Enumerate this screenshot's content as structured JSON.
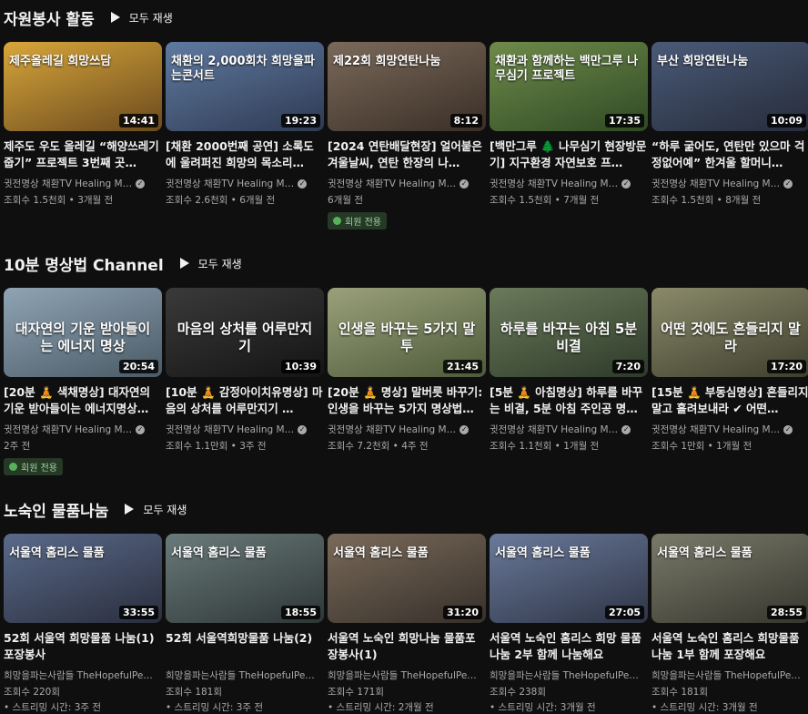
{
  "play_all_label": "모두 재생",
  "shelves": [
    {
      "title": "자원봉사 활동",
      "videos": [
        {
          "thumb_text": "제주올레길 희망쓰담",
          "duration": "14:41",
          "title": "제주도 우도 올레길 “해양쓰레기줍기” 프로젝트 3번째 곳…",
          "channel": "귓전명상 채환TV Healing M…",
          "views": "조회수 1.5천회 • 3개월 전",
          "badge": "",
          "colors": [
            "#d8a63a",
            "#6a4a1e"
          ]
        },
        {
          "thumb_text": "채환의 2,000회차 희망을파는콘서트",
          "duration": "19:23",
          "title": "[채환 2000번째 공연] 소록도에 울려퍼진 희망의 목소리…",
          "channel": "귓전명상 채환TV Healing M…",
          "views": "조회수 2.6천회 • 6개월 전",
          "badge": "",
          "colors": [
            "#5f7aa0",
            "#2e3a52"
          ]
        },
        {
          "thumb_text": "제22회 희망연탄나눔",
          "duration": "8:12",
          "title": "[2024 연탄배달현장] 얼어붙은 겨울날씨, 연탄 한장의 나…",
          "channel": "귓전명상 채환TV Healing M…",
          "views": "6개월 전",
          "badge": "회원 전용",
          "colors": [
            "#7a6a5a",
            "#3a2e26"
          ]
        },
        {
          "thumb_text": "채환과 함께하는 백만그루 나무심기 프로젝트",
          "duration": "17:35",
          "title": "[백만그루 🌲 나무심기 현장방문기] 지구환경 자연보호 프…",
          "channel": "귓전명상 채환TV Healing M…",
          "views": "조회수 1.5천회 • 7개월 전",
          "badge": "",
          "colors": [
            "#6f8a4a",
            "#2f4a24"
          ]
        },
        {
          "thumb_text": "부산 희망연탄나눔",
          "duration": "10:09",
          "title": "“하루 굶어도, 연탄만 있으마 걱정없어예” 한겨울 할머니…",
          "channel": "귓전명상 채환TV Healing M…",
          "views": "조회수 1.5천회 • 8개월 전",
          "badge": "",
          "colors": [
            "#4a5a78",
            "#262c3a"
          ]
        }
      ]
    },
    {
      "title": "10분 명상법 Channel",
      "videos": [
        {
          "thumb_text": "대자연의 기운 받아들이는 에너지 명상",
          "duration": "20:54",
          "title": "[20분 🧘 색채명상] 대자연의 기운 받아들이는 에너지명상…",
          "channel": "귓전명상 채환TV Healing M…",
          "views": "2주 전",
          "badge": "회원 전용",
          "colors": [
            "#8fa4b4",
            "#4a5a66"
          ]
        },
        {
          "thumb_text": "마음의 상처를 어루만지기",
          "duration": "10:39",
          "title": "[10분 🧘 감정아이치유명상] 마음의 상처를 어루만지기 …",
          "channel": "귓전명상 채환TV Healing M…",
          "views": "조회수 1.1만회 • 3주 전",
          "badge": "",
          "colors": [
            "#3a3a3a",
            "#141414"
          ]
        },
        {
          "thumb_text": "인생을 바꾸는 5가지 말투",
          "duration": "21:45",
          "title": "[20분 🧘 명상] 말버릇 바꾸기: 인생을 바꾸는 5가지 명상법…",
          "channel": "귓전명상 채환TV Healing M…",
          "views": "조회수 7.2천회 • 4주 전",
          "badge": "",
          "colors": [
            "#9aa07a",
            "#4e5a3a"
          ]
        },
        {
          "thumb_text": "하루를 바꾸는 아침 5분 비결",
          "duration": "7:20",
          "title": "[5분 🧘 아침명상] 하루를 바꾸는 비결, 5분 아침 주인공 명…",
          "channel": "귓전명상 채환TV Healing M…",
          "views": "조회수 1.1천회 • 1개월 전",
          "badge": "",
          "colors": [
            "#6a7a5a",
            "#2e3a2a"
          ]
        },
        {
          "thumb_text": "어떤 것에도 흔들리지 말라",
          "duration": "17:20",
          "title": "[15분 🧘 부동심명상] 흔들리지 말고 흘려보내라 ✔ 어떤…",
          "channel": "귓전명상 채환TV Healing M…",
          "views": "조회수 1만회 • 1개월 전",
          "badge": "",
          "colors": [
            "#8a8a6a",
            "#3e3e2e"
          ]
        }
      ]
    },
    {
      "title": "노숙인 물품나눔",
      "videos": [
        {
          "thumb_text": "서울역 홈리스 물품",
          "duration": "33:55",
          "title": "52회 서울역 희망물품 나눔(1) 포장봉사",
          "channel": "희망을파는사람들 TheHopefulPe…",
          "views": "조회수 220회",
          "views2": "• 스트리밍 시간: 3주 전",
          "badge": "",
          "colors": [
            "#5a6a8a",
            "#2a2e3e"
          ]
        },
        {
          "thumb_text": "서울역 홈리스 물품",
          "duration": "18:55",
          "title": "52회 서울역희망물품 나눔(2)",
          "channel": "희망을파는사람들 TheHopefulPe…",
          "views": "조회수 181회",
          "views2": "• 스트리밍 시간: 3주 전",
          "badge": "",
          "colors": [
            "#6a7a7a",
            "#2e3636"
          ]
        },
        {
          "thumb_text": "서울역 홈리스 물품",
          "duration": "31:20",
          "title": "서울역 노숙인 희망나눔 물품포장봉사(1)",
          "channel": "희망을파는사람들 TheHopefulPe…",
          "views": "조회수 171회",
          "views2": "• 스트리밍 시간: 2개월 전",
          "badge": "",
          "colors": [
            "#7a6a5a",
            "#36302a"
          ]
        },
        {
          "thumb_text": "서울역 홈리스 물품",
          "duration": "27:05",
          "title": "서울역 노숙인 홈리스 희망 물품 나눔 2부 함께 나눔해요",
          "channel": "희망을파는사람들 TheHopefulPe…",
          "views": "조회수 238회",
          "views2": "• 스트리밍 시간: 3개월 전",
          "badge": "",
          "colors": [
            "#6a7a9a",
            "#2e3446"
          ]
        },
        {
          "thumb_text": "서울역 홈리스 물품",
          "duration": "28:55",
          "title": "서울역 노숙인 홈리스 희망물품 나눔 1부 함께 포장해요",
          "channel": "희망을파는사람들 TheHopefulPe…",
          "views": "조회수 181회",
          "views2": "• 스트리밍 시간: 3개월 전",
          "badge": "",
          "colors": [
            "#7a7a6a",
            "#36362e"
          ]
        }
      ]
    }
  ]
}
